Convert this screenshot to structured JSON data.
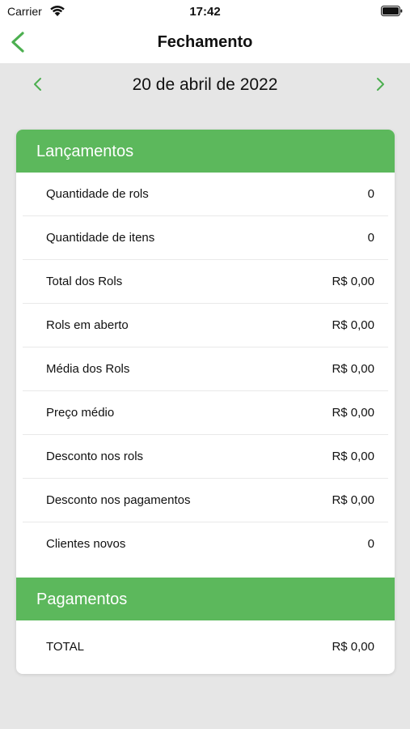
{
  "status_bar": {
    "carrier": "Carrier",
    "time": "17:42"
  },
  "nav": {
    "title": "Fechamento",
    "back_icon": "chevron-left-icon",
    "accent_color": "#4caf50"
  },
  "date_bar": {
    "date": "20 de abril de 2022",
    "prev_icon": "chevron-left-icon",
    "next_icon": "chevron-right-icon"
  },
  "sections": {
    "launches": {
      "title": "Lançamentos",
      "header_color": "#5cb85c",
      "rows": [
        {
          "label": "Quantidade de rols",
          "value": "0"
        },
        {
          "label": "Quantidade de itens",
          "value": "0"
        },
        {
          "label": "Total dos Rols",
          "value": "R$ 0,00"
        },
        {
          "label": "Rols em aberto",
          "value": "R$ 0,00"
        },
        {
          "label": "Média dos Rols",
          "value": "R$ 0,00"
        },
        {
          "label": "Preço médio",
          "value": "R$ 0,00"
        },
        {
          "label": "Desconto nos rols",
          "value": "R$ 0,00"
        },
        {
          "label": "Desconto nos pagamentos",
          "value": "R$ 0,00"
        },
        {
          "label": "Clientes novos",
          "value": "0"
        }
      ]
    },
    "payments": {
      "title": "Pagamentos",
      "header_color": "#5cb85c",
      "rows": [
        {
          "label": "TOTAL",
          "value": "R$ 0,00"
        }
      ]
    }
  }
}
